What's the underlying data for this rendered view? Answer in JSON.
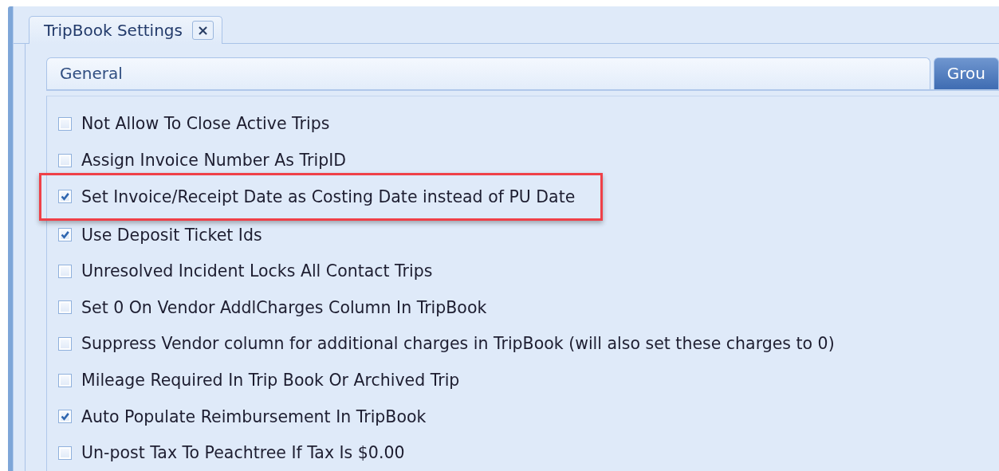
{
  "document_tab": {
    "title": "TripBook Settings",
    "close": "×"
  },
  "tabs": [
    {
      "label": "General",
      "selected": true
    },
    {
      "label": "Grou",
      "selected": false
    }
  ],
  "options": [
    {
      "label": "Not Allow To Close Active Trips",
      "checked": false,
      "highlighted": false
    },
    {
      "label": "Assign Invoice Number As TripID",
      "checked": false,
      "highlighted": false
    },
    {
      "label": "Set Invoice/Receipt Date as Costing Date instead of PU Date",
      "checked": true,
      "highlighted": true
    },
    {
      "label": "Use Deposit Ticket Ids",
      "checked": true,
      "highlighted": false
    },
    {
      "label": "Unresolved Incident Locks All Contact Trips",
      "checked": false,
      "highlighted": false
    },
    {
      "label": "Set 0 On Vendor AddlCharges Column In TripBook",
      "checked": false,
      "highlighted": false
    },
    {
      "label": "Suppress Vendor column for additional charges in TripBook (will also set these charges to 0)",
      "checked": false,
      "highlighted": false
    },
    {
      "label": "Mileage Required In Trip Book Or Archived Trip",
      "checked": false,
      "highlighted": false
    },
    {
      "label": "Auto Populate Reimbursement In TripBook",
      "checked": true,
      "highlighted": false
    },
    {
      "label": "Un-post Tax To Peachtree If Tax Is $0.00",
      "checked": false,
      "highlighted": false
    }
  ]
}
